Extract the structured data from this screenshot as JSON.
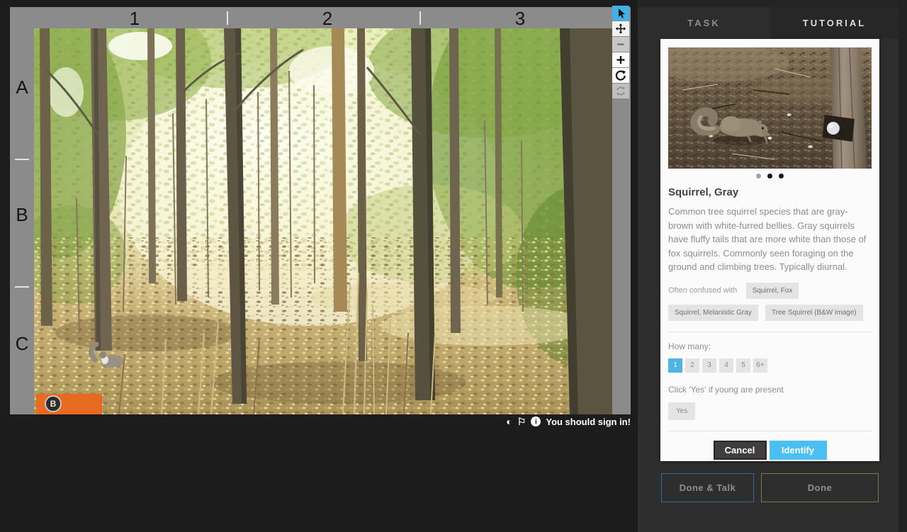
{
  "viewer": {
    "column_labels": [
      "1",
      "2",
      "3"
    ],
    "row_labels": [
      "A",
      "B",
      "C"
    ],
    "toolbar": [
      {
        "label": "select",
        "icon": "cursor-icon",
        "active": true
      },
      {
        "label": "pan",
        "icon": "move-icon",
        "active": false
      },
      {
        "label": "zoom-out",
        "icon": "minus-icon",
        "active": false
      },
      {
        "label": "zoom-in",
        "icon": "plus-icon",
        "active": false
      },
      {
        "label": "rotate",
        "icon": "rotate-icon",
        "active": false
      },
      {
        "label": "reset",
        "icon": "refresh-icon",
        "active": false
      }
    ],
    "watermark_letter": "B",
    "status": {
      "contrast_glyph": "◐",
      "flag_glyph": "⚐",
      "info_glyph": "i",
      "message": "You should sign in!"
    }
  },
  "panel": {
    "tabs": {
      "task": "TASK",
      "tutorial": "TUTORIAL",
      "active": "TUTORIAL"
    },
    "card": {
      "carousel_dot_count": 3,
      "carousel_active_dot": 1,
      "title": "Squirrel, Gray",
      "description": "Common tree squirrel species that are gray-brown with white-furred bellies. Gray squirrels have fluffy tails that are more white than those of fox squirrels. Commonly seen foraging on the ground and climbing trees. Typically diurnal.",
      "confused_label": "Often confused with",
      "chips": [
        "Squirrel, Fox",
        "Squirrel, Melanistic Gray",
        "Tree Squirrel (B&W image)"
      ],
      "how_many_label": "How many:",
      "counts": [
        "1",
        "2",
        "3",
        "4",
        "5",
        "6+"
      ],
      "selected_count": "1",
      "young_label": "Click 'Yes' if young are present",
      "young_button_label": "Yes",
      "cancel_label": "Cancel",
      "identify_label": "Identify"
    },
    "footer": {
      "done_talk_label": "Done & Talk",
      "done_label": "Done"
    }
  },
  "colors": {
    "selected_count_blue": "#4db4e7",
    "identify_blue": "#4ac0f2",
    "tool_active_blue": "#3fb0e8",
    "done_border_green": "#6e7c45",
    "done_talk_border_blue": "#2e6e90",
    "ruler_gray": "#8b8b8b",
    "panel_bg": "#2e2e2e",
    "watermark_orange": "#e66a1f"
  }
}
